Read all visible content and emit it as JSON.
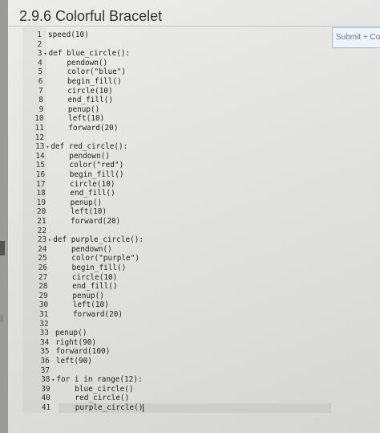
{
  "title": "2.9.6 Colorful Bracelet",
  "submit_label": "Submit + Con",
  "code_lines": [
    {
      "n": "1",
      "fold": false,
      "indent": 0,
      "text": "speed(10)"
    },
    {
      "n": "2",
      "fold": false,
      "indent": 0,
      "text": ""
    },
    {
      "n": "3",
      "fold": true,
      "indent": 0,
      "text": "def blue_circle():"
    },
    {
      "n": "4",
      "fold": false,
      "indent": 1,
      "text": "pendown()"
    },
    {
      "n": "5",
      "fold": false,
      "indent": 1,
      "text": "color(\"blue\")"
    },
    {
      "n": "6",
      "fold": false,
      "indent": 1,
      "text": "begin_fill()"
    },
    {
      "n": "7",
      "fold": false,
      "indent": 1,
      "text": "circle(10)"
    },
    {
      "n": "8",
      "fold": false,
      "indent": 1,
      "text": "end_fill()"
    },
    {
      "n": "9",
      "fold": false,
      "indent": 1,
      "text": "penup()"
    },
    {
      "n": "10",
      "fold": false,
      "indent": 1,
      "text": "left(10)"
    },
    {
      "n": "11",
      "fold": false,
      "indent": 1,
      "text": "forward(20)"
    },
    {
      "n": "12",
      "fold": false,
      "indent": 0,
      "text": ""
    },
    {
      "n": "13",
      "fold": true,
      "indent": 0,
      "text": "def red_circle():"
    },
    {
      "n": "14",
      "fold": false,
      "indent": 1,
      "text": "pendown()"
    },
    {
      "n": "15",
      "fold": false,
      "indent": 1,
      "text": "color(\"red\")"
    },
    {
      "n": "16",
      "fold": false,
      "indent": 1,
      "text": "begin_fill()"
    },
    {
      "n": "17",
      "fold": false,
      "indent": 1,
      "text": "circle(10)"
    },
    {
      "n": "18",
      "fold": false,
      "indent": 1,
      "text": "end_fill()"
    },
    {
      "n": "19",
      "fold": false,
      "indent": 1,
      "text": "penup()"
    },
    {
      "n": "20",
      "fold": false,
      "indent": 1,
      "text": "left(10)"
    },
    {
      "n": "21",
      "fold": false,
      "indent": 1,
      "text": "forward(20)"
    },
    {
      "n": "22",
      "fold": false,
      "indent": 0,
      "text": ""
    },
    {
      "n": "23",
      "fold": true,
      "indent": 0,
      "text": "def purple_circle():"
    },
    {
      "n": "24",
      "fold": false,
      "indent": 1,
      "text": "pendown()"
    },
    {
      "n": "25",
      "fold": false,
      "indent": 1,
      "text": "color(\"purple\")"
    },
    {
      "n": "26",
      "fold": false,
      "indent": 1,
      "text": "begin_fill()"
    },
    {
      "n": "27",
      "fold": false,
      "indent": 1,
      "text": "circle(10)"
    },
    {
      "n": "28",
      "fold": false,
      "indent": 1,
      "text": "end_fill()"
    },
    {
      "n": "29",
      "fold": false,
      "indent": 1,
      "text": "penup()"
    },
    {
      "n": "30",
      "fold": false,
      "indent": 1,
      "text": "left(10)"
    },
    {
      "n": "31",
      "fold": false,
      "indent": 1,
      "text": "forward(20)"
    },
    {
      "n": "32",
      "fold": false,
      "indent": 0,
      "text": ""
    },
    {
      "n": "33",
      "fold": false,
      "indent": 0,
      "text": "penup()"
    },
    {
      "n": "34",
      "fold": false,
      "indent": 0,
      "text": "right(90)"
    },
    {
      "n": "35",
      "fold": false,
      "indent": 0,
      "text": "forward(100)"
    },
    {
      "n": "36",
      "fold": false,
      "indent": 0,
      "text": "left(90)"
    },
    {
      "n": "37",
      "fold": false,
      "indent": 0,
      "text": ""
    },
    {
      "n": "38",
      "fold": true,
      "indent": 0,
      "text": "for i in range(12):"
    },
    {
      "n": "39",
      "fold": false,
      "indent": 1,
      "text": "blue_circle()"
    },
    {
      "n": "40",
      "fold": false,
      "indent": 1,
      "text": "red_circle()"
    },
    {
      "n": "41",
      "fold": false,
      "indent": 1,
      "text": "purple_circle()"
    }
  ],
  "fold_icon": "triangle-down-icon",
  "indent_unit": "    ",
  "colors": {
    "background": "#e4e4e1",
    "text": "#222222",
    "submit_border": "#9db8cf",
    "submit_text": "#5a7d99"
  }
}
